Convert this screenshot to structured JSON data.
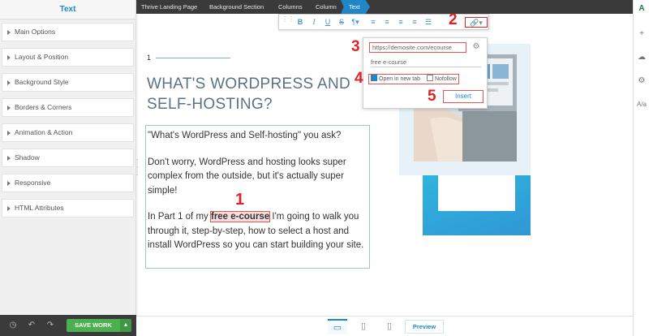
{
  "sidebar": {
    "title": "Text",
    "panels": [
      "Main Options",
      "Layout & Position",
      "Background Style",
      "Borders & Corners",
      "Animation & Action",
      "Shadow",
      "Responsive",
      "HTML Attributes"
    ],
    "save_label": "SAVE WORK"
  },
  "breadcrumb": [
    "Thrive Landing Page",
    "Background Section",
    "Columns",
    "Column",
    "Text"
  ],
  "canvas": {
    "number": "1",
    "heading_line1": "WHAT'S WORDPRESS AND",
    "heading_line2": "SELF-HOSTING?",
    "para1": "\"What's WordPress and Self-hosting\" you ask?",
    "para2": "Don't worry, WordPress and hosting looks super complex from the outside, but it's actually super simple!",
    "para3_before": "In Part 1 of my ",
    "para3_link": "free e-course",
    "para3_after": " I'm going to walk you through it, step-by-step, how to select a host and install WordPress so you can start building your site."
  },
  "link_popup": {
    "url": "https://demosite.com/ecourse",
    "anchor_text": "free e-course",
    "open_new_tab_label": "Open in new tab",
    "open_new_tab_checked": true,
    "nofollow_label": "Nofollow",
    "nofollow_checked": false,
    "insert_label": "Insert"
  },
  "annotations": [
    "1",
    "2",
    "3",
    "4",
    "5"
  ],
  "bottom": {
    "preview_label": "Preview"
  },
  "colors": {
    "accent": "#1f86c7",
    "save": "#4caf50",
    "annotation": "#e02222",
    "heading": "#5c7186"
  }
}
